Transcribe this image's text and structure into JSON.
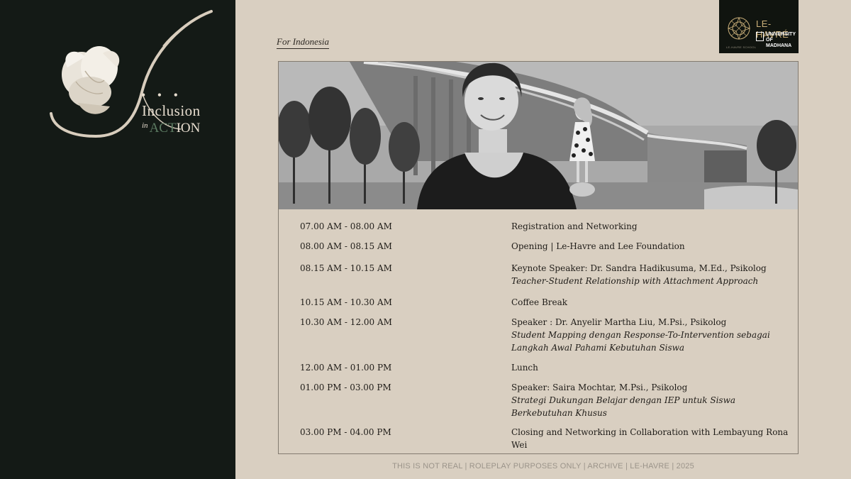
{
  "brand": {
    "line1": "Inclusion",
    "line2_small": "in",
    "line2_accent": "ACT",
    "line2_rest": "ION",
    "dots": "• • •"
  },
  "logo": {
    "name": "LE-HAVRÉ",
    "university_line1": "UNIVERSITY",
    "university_line2": "OF MADHANA",
    "emblem_caption": "LE-HAVRE SCHOOL"
  },
  "region_label": "For Indonesia",
  "schedule": [
    {
      "time": "07.00 AM - 08.00 AM",
      "title": "Registration and Networking",
      "subtitle": ""
    },
    {
      "time": "08.00 AM - 08.15 AM",
      "title": "Opening | Le-Havre and Lee Foundation",
      "subtitle": ""
    },
    {
      "time": "08.15 AM - 10.15 AM",
      "title": "Keynote Speaker: Dr. Sandra Hadikusuma, M.Ed., Psikolog",
      "subtitle": "Teacher-Student Relationship with Attachment Approach"
    },
    {
      "time": "10.15 AM - 10.30 AM",
      "title": "Coffee Break",
      "subtitle": ""
    },
    {
      "time": "10.30 AM - 12.00 AM",
      "title": "Speaker : Dr. Anyelir Martha Liu, M.Psi., Psikolog",
      "subtitle": "Student Mapping dengan Response-To-Intervention sebagai Langkah Awal Pahami Kebutuhan Siswa"
    },
    {
      "time": "12.00 AM - 01.00 PM",
      "title": "Lunch",
      "subtitle": ""
    },
    {
      "time": "01.00 PM - 03.00 PM",
      "title": "Speaker: Saira Mochtar, M.Psi., Psikolog",
      "subtitle": "Strategi Dukungan Belajar dengan IEP untuk Siswa Berkebutuhan Khusus"
    },
    {
      "time": "03.00 PM - 04.00 PM",
      "title": "Closing and Networking in Collaboration with Lembayung Rona Wei",
      "subtitle": ""
    }
  ],
  "footer": "THIS IS NOT REAL | ROLEPLAY PURPOSES ONLY | ARCHIVE | LE-HAVRE | 2025"
}
